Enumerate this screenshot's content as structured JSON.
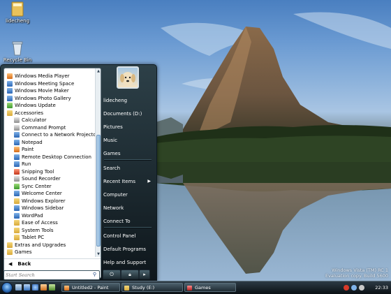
{
  "desktop": {
    "icons": [
      {
        "label": "lidecheng",
        "icon": "folder-icon"
      },
      {
        "label": "Recycle Bin",
        "icon": "recycle-bin-icon"
      }
    ],
    "watermark_line1": "Windows Vista (TM) RC 1",
    "watermark_line2": "Evaluation copy. Build 5600"
  },
  "start_menu": {
    "programs": [
      {
        "label": "Windows Media Player",
        "level": 0,
        "icon": "ic-orange"
      },
      {
        "label": "Windows Meeting Space",
        "level": 0,
        "icon": "ic-app"
      },
      {
        "label": "Windows Movie Maker",
        "level": 0,
        "icon": "ic-app"
      },
      {
        "label": "Windows Photo Gallery",
        "level": 0,
        "icon": "ic-app"
      },
      {
        "label": "Windows Update",
        "level": 0,
        "icon": "ic-green"
      },
      {
        "label": "Accessories",
        "level": 0,
        "icon": "ic-folder"
      },
      {
        "label": "Calculator",
        "level": 1,
        "icon": "ic-gray"
      },
      {
        "label": "Command Prompt",
        "level": 1,
        "icon": "ic-gray"
      },
      {
        "label": "Connect to a Network Projector",
        "level": 1,
        "icon": "ic-app"
      },
      {
        "label": "Notepad",
        "level": 1,
        "icon": "ic-app"
      },
      {
        "label": "Paint",
        "level": 1,
        "icon": "ic-orange"
      },
      {
        "label": "Remote Desktop Connection",
        "level": 1,
        "icon": "ic-app"
      },
      {
        "label": "Run",
        "level": 1,
        "icon": "ic-app"
      },
      {
        "label": "Snipping Tool",
        "level": 1,
        "icon": "ic-red"
      },
      {
        "label": "Sound Recorder",
        "level": 1,
        "icon": "ic-gray"
      },
      {
        "label": "Sync Center",
        "level": 1,
        "icon": "ic-green"
      },
      {
        "label": "Welcome Center",
        "level": 1,
        "icon": "ic-app"
      },
      {
        "label": "Windows Explorer",
        "level": 1,
        "icon": "ic-folder"
      },
      {
        "label": "Windows Sidebar",
        "level": 1,
        "icon": "ic-app"
      },
      {
        "label": "WordPad",
        "level": 1,
        "icon": "ic-app"
      },
      {
        "label": "Ease of Access",
        "level": 1,
        "icon": "ic-folder"
      },
      {
        "label": "System Tools",
        "level": 1,
        "icon": "ic-folder"
      },
      {
        "label": "Tablet PC",
        "level": 1,
        "icon": "ic-folder"
      },
      {
        "label": "Extras and Upgrades",
        "level": 0,
        "icon": "ic-folder"
      },
      {
        "label": "Games",
        "level": 0,
        "icon": "ic-folder"
      }
    ],
    "back_label": "Back",
    "search_placeholder": "Start Search",
    "right_items": [
      {
        "label": "lidecheng",
        "submenu": false
      },
      {
        "label": "Documents (D:)",
        "submenu": false
      },
      {
        "label": "Pictures",
        "submenu": false
      },
      {
        "label": "Music",
        "submenu": false
      },
      {
        "label": "Games",
        "submenu": false
      },
      {
        "label": "Search",
        "submenu": false
      },
      {
        "label": "Recent Items",
        "submenu": true
      },
      {
        "label": "Computer",
        "submenu": false
      },
      {
        "label": "Network",
        "submenu": false
      },
      {
        "label": "Connect To",
        "submenu": false
      },
      {
        "label": "Control Panel",
        "submenu": false
      },
      {
        "label": "Default Programs",
        "submenu": false
      },
      {
        "label": "Help and Support",
        "submenu": false
      }
    ]
  },
  "taskbar": {
    "buttons": [
      {
        "label": "Untitled2 - Paint",
        "icon": "paint-icon"
      },
      {
        "label": "Study (E:)",
        "icon": "folder-icon"
      },
      {
        "label": "Games",
        "icon": "games-icon"
      }
    ],
    "clock": "22:33"
  }
}
